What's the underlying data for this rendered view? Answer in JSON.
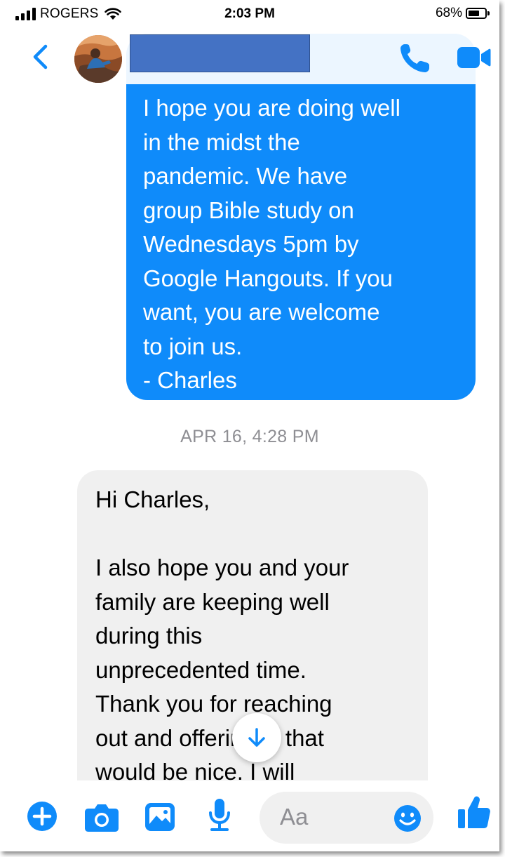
{
  "status_bar": {
    "carrier": "ROGERS",
    "time": "2:03 PM",
    "battery_percent": "68%",
    "battery_level": 0.68
  },
  "header": {
    "back_icon": "chevron-left-icon",
    "call_icon": "phone-icon",
    "video_icon": "video-camera-icon"
  },
  "conversation": {
    "outgoing_message": "I hope you are doing well\nin the midst the\npandemic. We have\ngroup Bible study on\nWednesdays 5pm by\nGoogle Hangouts. If you\nwant, you are welcome\nto join us.\n- Charles",
    "timestamp": "APR 16, 4:28 PM",
    "incoming_message": "Hi Charles,\n\nI also hope you and your\nfamily are keeping well\nduring this\nunprecedented time.\nThank you for reaching\nout and offering— that\nwould be nice. I will"
  },
  "composer": {
    "placeholder": "Aa",
    "icons": [
      "plus-icon",
      "camera-icon",
      "image-icon",
      "microphone-icon",
      "emoji-icon",
      "thumbs-up-icon"
    ]
  },
  "colors": {
    "accent": "#0f8bfa",
    "incoming_bubble": "#f0f0f0",
    "timestamp": "#8e8e93",
    "redaction": "#4472c4"
  }
}
